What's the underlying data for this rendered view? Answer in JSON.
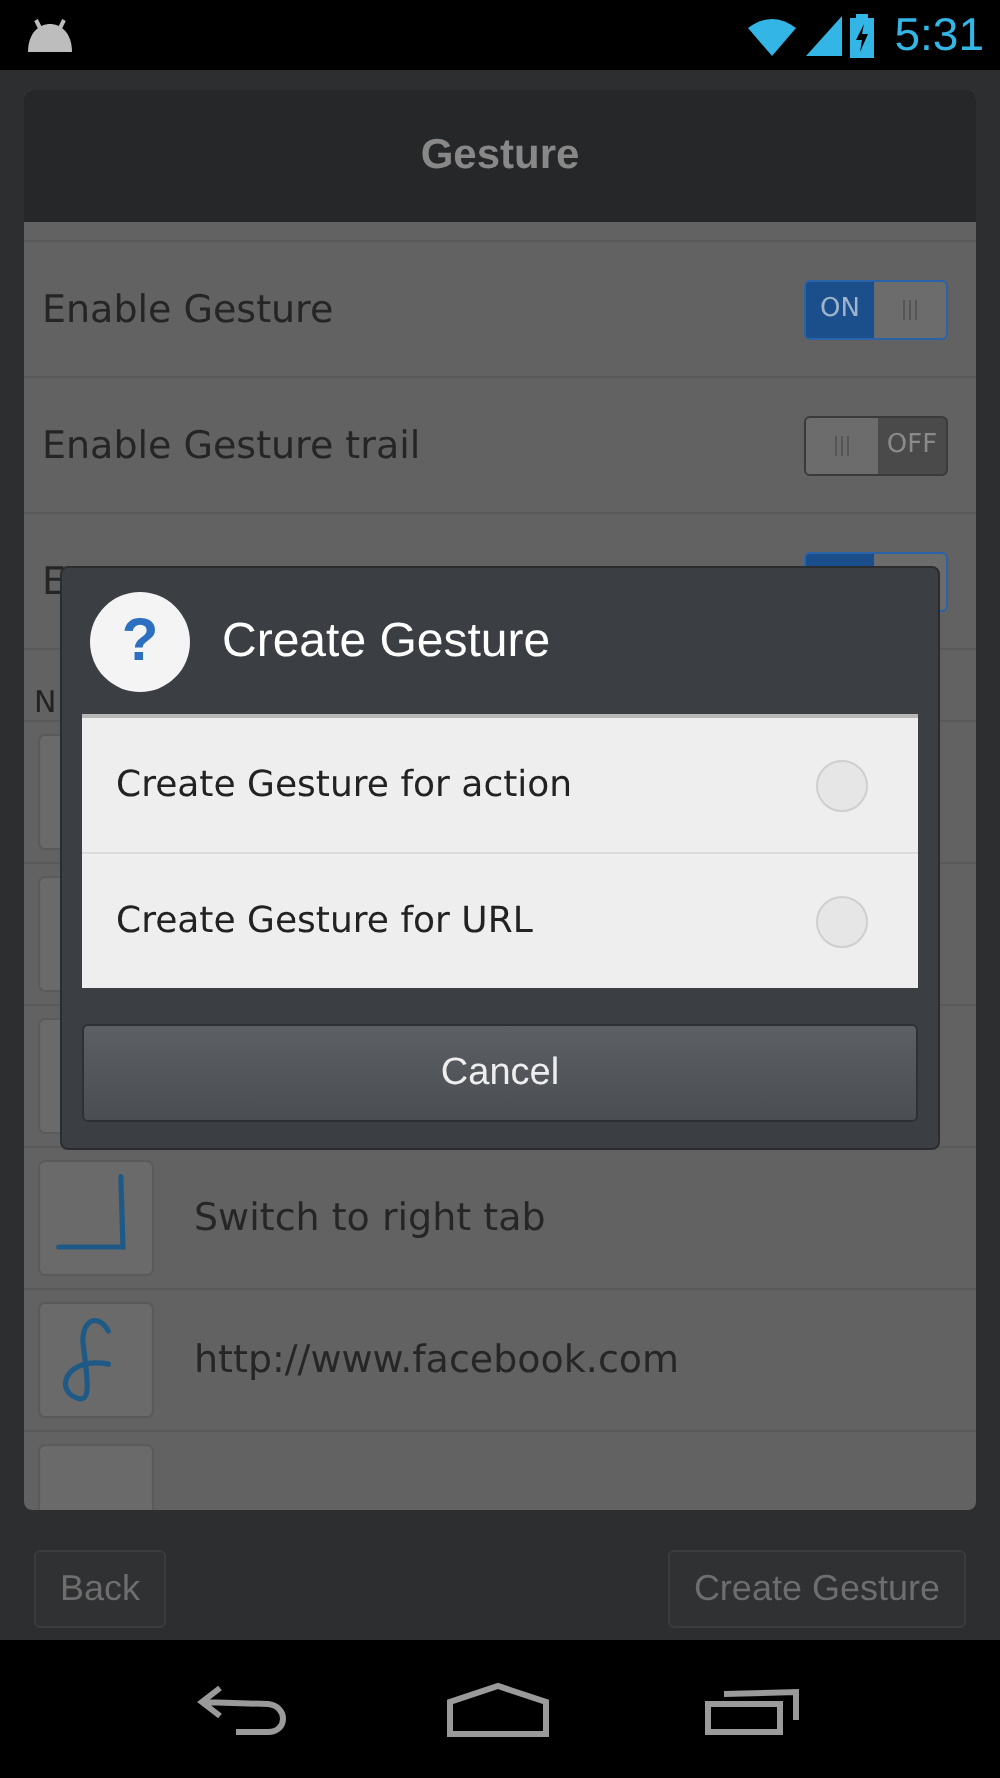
{
  "status_bar": {
    "time": "5:31"
  },
  "header": {
    "title": "Gesture"
  },
  "settings": [
    {
      "label": "Enable Gesture",
      "on": true,
      "switch_text": "ON"
    },
    {
      "label": "Enable Gesture trail",
      "on": false,
      "switch_text": "OFF"
    },
    {
      "label": "E",
      "on": true
    }
  ],
  "section_header": "N",
  "gestures": [
    {
      "kind": "gesture"
    },
    {
      "kind": "gesture"
    },
    {
      "kind": "gesture"
    },
    {
      "kind": "gesture",
      "label": "Switch to right tab"
    },
    {
      "kind": "gesture",
      "label": "http://www.facebook.com"
    },
    {
      "kind": "gesture"
    }
  ],
  "dialog": {
    "icon": "?",
    "title": "Create Gesture",
    "options": [
      {
        "label": "Create Gesture for action",
        "selected": false
      },
      {
        "label": "Create Gesture for URL",
        "selected": false
      }
    ],
    "cancel": "Cancel"
  },
  "footer_buttons": [
    "Back",
    "Create Gesture"
  ]
}
